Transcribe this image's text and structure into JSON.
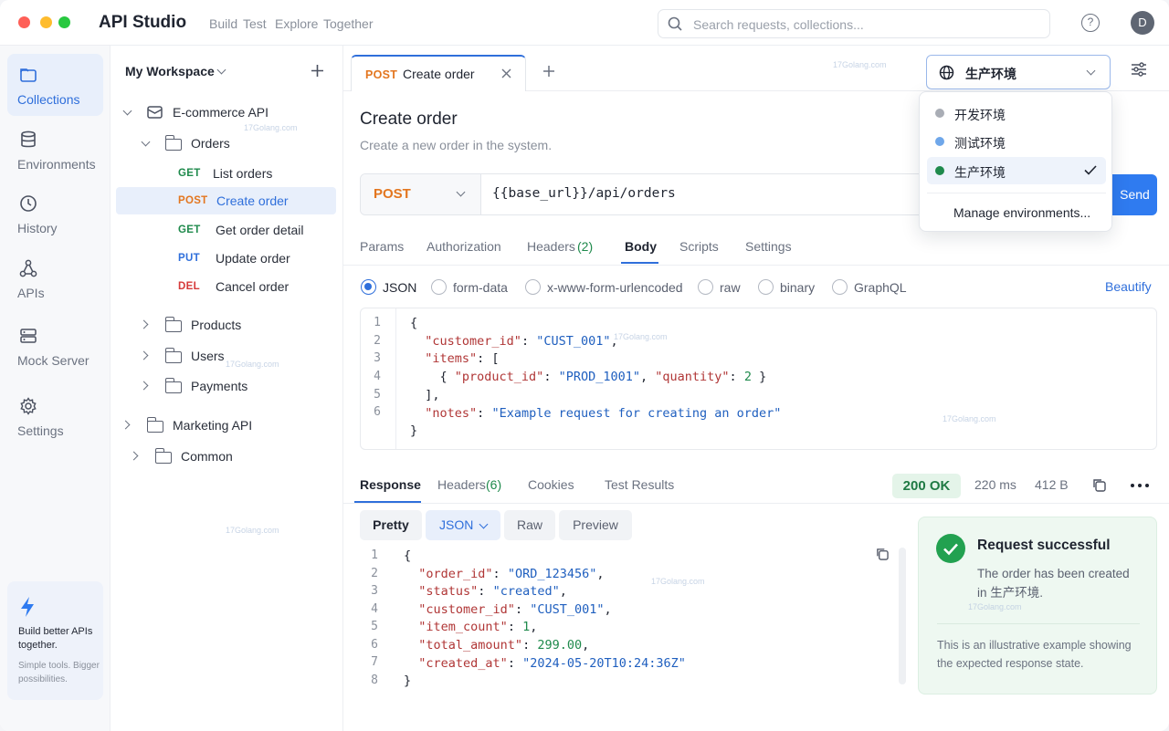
{
  "window": {
    "title": "API Studio",
    "menu": [
      "Build",
      "Test",
      "Explore",
      "Together"
    ]
  },
  "search": {
    "placeholder": "Search requests, collections..."
  },
  "header": {
    "help": "?",
    "avatar": "D"
  },
  "rail": {
    "items": [
      {
        "label": "Collections",
        "icon": "folder-icon",
        "active": true
      },
      {
        "label": "Environments",
        "icon": "database-icon"
      },
      {
        "label": "History",
        "icon": "clock-icon"
      },
      {
        "label": "APIs",
        "icon": "graph-icon"
      },
      {
        "label": "Mock Server",
        "icon": "server-icon"
      },
      {
        "label": "Settings",
        "icon": "gear-icon"
      }
    ],
    "promo": {
      "title": "Build better APIs together.",
      "sub": "Simple tools. Bigger possibilities."
    }
  },
  "tree": {
    "workspace": "My Workspace",
    "collection": "E-commerce API",
    "folder_orders": "Orders",
    "requests": [
      {
        "method": "GET",
        "name": "List orders"
      },
      {
        "method": "POST",
        "name": "Create order"
      },
      {
        "method": "GET",
        "name": "Get order detail"
      },
      {
        "method": "PUT",
        "name": "Update order"
      },
      {
        "method": "DEL",
        "name": "Cancel order"
      }
    ],
    "folders": [
      "Products",
      "Users",
      "Payments"
    ],
    "collections": [
      "Marketing API",
      "Common"
    ]
  },
  "tab": {
    "method": "POST",
    "title": "Create order"
  },
  "env": {
    "selected": "生产环境",
    "options": [
      {
        "label": "开发环境",
        "color": "#a9adb5"
      },
      {
        "label": "测试环境",
        "color": "#6fa7ea"
      },
      {
        "label": "生产环境",
        "color": "#1f8a4c"
      }
    ],
    "manage": "Manage environments..."
  },
  "request": {
    "title": "Create order",
    "subtitle": "Create a new order in the system.",
    "method": "POST",
    "url": "{{base_url}}/api/orders",
    "send": "Send",
    "tabs": [
      "Params",
      "Authorization",
      "Headers",
      "(2)",
      "Body",
      "Scripts",
      "Settings"
    ],
    "body_types": [
      "JSON",
      "form-data",
      "x-www-form-urlencoded",
      "raw",
      "binary",
      "GraphQL"
    ],
    "beautify": "Beautify",
    "line_numbers": [
      "1",
      "2",
      "3",
      "4",
      "5",
      "6"
    ]
  },
  "response": {
    "tabs": [
      "Response",
      "Headers",
      "(6)",
      "Cookies",
      "Test Results"
    ],
    "status": "200 OK",
    "time": "220 ms",
    "size": "412 B",
    "formats": [
      "Pretty",
      "JSON",
      "Raw",
      "Preview"
    ],
    "line_numbers": [
      "1",
      "2",
      "3",
      "4",
      "5",
      "6",
      "7",
      "8"
    ]
  },
  "success": {
    "title": "Request successful",
    "message": "The order has been created in 生产环境.",
    "note": "This is an illustrative example showing the expected response state."
  },
  "watermark": "17Golang.com"
}
